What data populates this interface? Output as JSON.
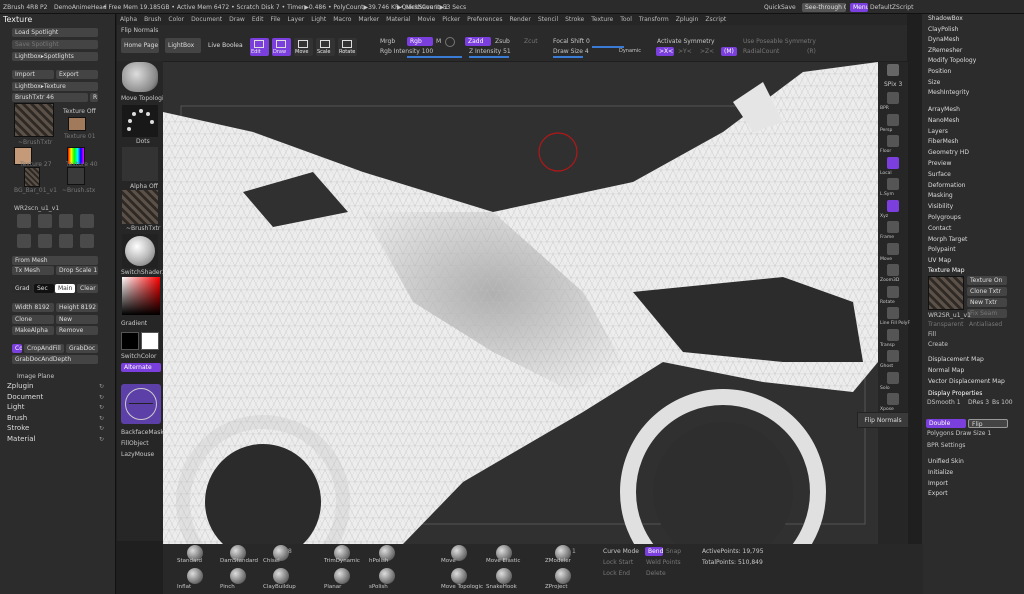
{
  "titlebar": {
    "app": "ZBrush 4R8 P2",
    "doc": "DemoAnimeHead",
    "stats": "• Free Mem 19.185GB • Active Mem 6472 • Scratch Disk 7 • Timer▶0.486 • PolyCount▶39.746 KP • MeshCount▶1",
    "quicksave_info": "▶QuickSave In 53 Secs",
    "quicksave": "QuickSave",
    "seethrough": "See-through",
    "seethrough_val": "0",
    "menus": "Menus",
    "script": "DefaultZScript"
  },
  "menubar": [
    "Alpha",
    "Brush",
    "Color",
    "Document",
    "Draw",
    "Edit",
    "File",
    "Layer",
    "Light",
    "Macro",
    "Marker",
    "Material",
    "Movie",
    "Picker",
    "Preferences",
    "Render",
    "Stencil",
    "Stroke",
    "Texture",
    "Tool",
    "Transform",
    "Zplugin",
    "Zscript"
  ],
  "left": {
    "title": "Texture",
    "load_spotlight": "Load Spotlight",
    "save_spotlight": "Save Spotlight",
    "lightbox_spotlights": "Lightbox▸Spotlights",
    "import": "Import",
    "export": "Export",
    "lightbox_texture": "Lightbox▸Texture",
    "brushtxtr": "BrushTxtr",
    "brushtxtr_val": "46",
    "r_label": "R",
    "thumb_labels": [
      "~BrushTxtr",
      "Texture 01",
      "Texture 27",
      "Texture 40",
      "BG_Bar_01_v1",
      "~Brush.stx"
    ],
    "texture_off": "Texture Off",
    "wr_label": "WR2scn_u1_v1",
    "small_icons": [
      "Flip H",
      "Flip V",
      "Rotate",
      "Inverse",
      "Grad",
      "CropAndFill",
      "GrabDoc",
      "Clone"
    ],
    "from_mesh": "From Mesh",
    "tx_mesh": "Tx Mesh",
    "drop_scale": "Drop Scale",
    "drop_scale_val": "1",
    "grad": "Grad",
    "sec": "Sec",
    "main": "Main",
    "clear": "Clear",
    "width": "Width",
    "width_val": "8192",
    "height": "Height",
    "height_val": "8192",
    "clone": "Clone",
    "new": "New",
    "makealpha": "MakeAlpha",
    "remove": "Remove",
    "cc": "Cd",
    "cropandfill": "CropAndFill",
    "grabdoc": "GrabDoc",
    "grabdocanddepth": "GrabDocAndDepth",
    "image_plane": "Image Plane",
    "sections": [
      "Zplugin",
      "Document",
      "Light",
      "Brush",
      "Stroke",
      "Material"
    ]
  },
  "shelf": {
    "flip_normals": "Flip Normals",
    "home_page": "Home Page",
    "lightbox": "LightBox",
    "live_boolean": "Live Boolean",
    "tools": [
      "Edit",
      "Draw",
      "Move",
      "Scale",
      "Rotate"
    ],
    "mrgb": "Mrgb",
    "rgb": "Rgb",
    "m": "M",
    "rgb_intensity": "Rgb Intensity",
    "rgb_intensity_val": "100",
    "zadd": "Zadd",
    "zsub": "Zsub",
    "zcut": "Zcut",
    "z_intensity": "Z Intensity",
    "z_intensity_val": "51",
    "focal_shift": "Focal Shift",
    "focal_shift_val": "0",
    "draw_size": "Draw Size",
    "draw_size_val": "4",
    "dynamic": "Dynamic",
    "activate_symmetry": "Activate Symmetry",
    "sym_axes": [
      ">X<",
      ">Y<",
      ">Z<",
      "(M)"
    ],
    "use_poseable": "Use Poseable Symmetry",
    "radial_count": "RadialCount",
    "radial_val": "(R)"
  },
  "toolcol": {
    "move_topologic": "Move Topologic",
    "dots": "Dots",
    "alpha_off": "Alpha Off",
    "brushtxtr": "~BrushTxtr",
    "switch_shader": "SwitchShader2",
    "gradient": "Gradient",
    "switchcolor": "SwitchColor",
    "alternate": "Alternate",
    "backface_mask": "BackfaceMask",
    "fillobject": "FillObject",
    "lazymouse": "LazyMouse"
  },
  "rightshelf": {
    "spix": "SPix",
    "spix_val": "3",
    "items": [
      "BPR",
      "Persp",
      "Floor",
      "Local",
      "L.Sym",
      "Xyz",
      "Frame",
      "Move",
      "Zoom3D",
      "Rotate",
      "Line Fill PolyF",
      "Transp",
      "Ghost",
      "Solo",
      "Xpose"
    ]
  },
  "tooltip": "Flip Normals",
  "rightpanel": {
    "top_items": [
      "ShadowBox",
      "ClayPolish",
      "DynaMesh",
      "ZRemesher",
      "Modify Topology",
      "Position",
      "Size",
      "MeshIntegrity"
    ],
    "mid_items": [
      "ArrayMesh",
      "NanoMesh",
      "Layers",
      "FiberMesh",
      "Geometry HD",
      "Preview",
      "Surface",
      "Deformation",
      "Masking",
      "Visibility",
      "Polygroups",
      "Contact",
      "Morph Target",
      "Polypaint",
      "UV Map"
    ],
    "texture_map": "Texture Map",
    "texture_on": "Texture On",
    "clone_txtr": "Clone Txtr",
    "new_txtr": "New Txtr",
    "fix_seam": "Fix Seam",
    "antialiased": "Antialiased",
    "tm_label": "WR2SR_u1_v1",
    "transparent": "Transparent",
    "fill": "Fill",
    "create": "Create",
    "more_items": [
      "Displacement Map",
      "Normal Map",
      "Vector Displacement Map"
    ],
    "display_properties": "Display Properties",
    "dsmooth": "DSmooth",
    "dsmooth_val": "1",
    "dres": "DRes",
    "dres_val": "3",
    "bs": "Bs",
    "bs_val": "100",
    "double": "Double",
    "flip": "Flip",
    "polygons_draw_size": "Polygons Draw Size",
    "pds_val": "1",
    "bpr_settings": "BPR Settings",
    "end_items": [
      "Unified Skin",
      "Initialize",
      "Import",
      "Export"
    ]
  },
  "bottom": {
    "brushes": [
      "Standard",
      "DamStandard",
      "Chisel",
      "TrimDynamic",
      "hPolish",
      "Move",
      "Move Elastic",
      "ZModeler",
      "Inflat",
      "Pinch",
      "ClayBuildup",
      "Planar",
      "sPolish",
      "Move Topologic",
      "SnakeHook",
      "ZProject"
    ],
    "chisel_num": "8",
    "zmodeler_num": "1",
    "curve_mode": "Curve Mode",
    "lock_start": "Lock Start",
    "lock_end": "Lock End",
    "snap": "Snap",
    "bend": "Bend",
    "weld_points": "Weld Points",
    "delete": "Delete",
    "active_points": "ActivePoints: 19,795",
    "total_points": "TotalPoints: 510,849"
  },
  "colors": {
    "accent": "#7a3fdc",
    "slider": "#3a7bd5",
    "bg": "#1f1f1f",
    "panel": "#2c2c2c"
  }
}
